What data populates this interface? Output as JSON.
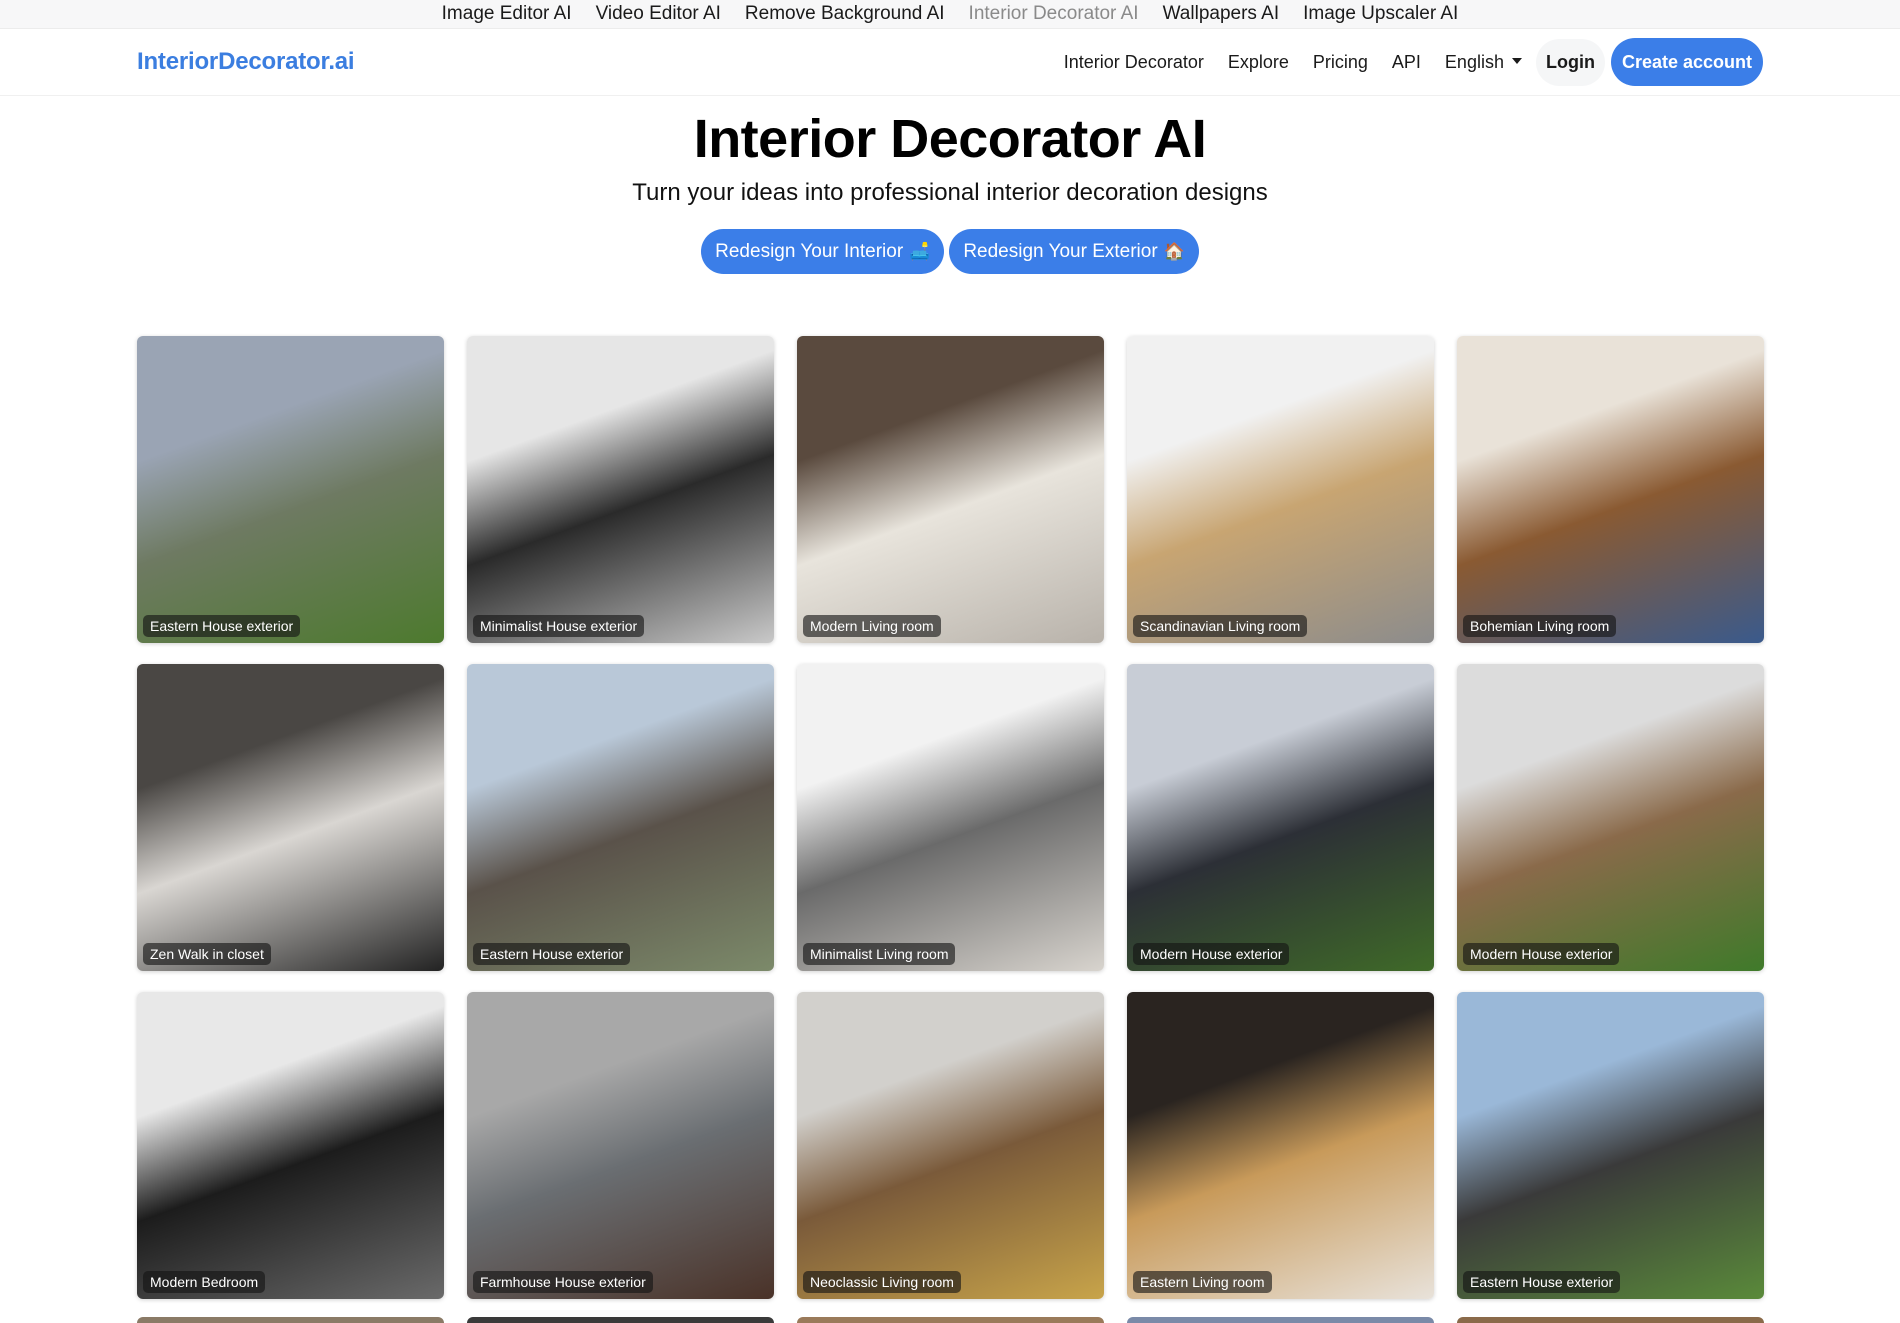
{
  "product_bar": {
    "items": [
      {
        "label": "Image Editor AI",
        "active": false
      },
      {
        "label": "Video Editor AI",
        "active": false
      },
      {
        "label": "Remove Background AI",
        "active": false
      },
      {
        "label": "Interior Decorator AI",
        "active": true
      },
      {
        "label": "Wallpapers AI",
        "active": false
      },
      {
        "label": "Image Upscaler AI",
        "active": false
      }
    ]
  },
  "navbar": {
    "brand": "InteriorDecorator.ai",
    "links": [
      "Interior Decorator",
      "Explore",
      "Pricing",
      "API"
    ],
    "language": "English",
    "login_label": "Login",
    "create_account_label": "Create account"
  },
  "hero": {
    "title": "Interior Decorator AI",
    "subtitle": "Turn your ideas into professional interior decoration designs",
    "buttons": [
      {
        "label": "Redesign Your Interior",
        "emoji": "🛋️"
      },
      {
        "label": "Redesign Your Exterior",
        "emoji": "🏠"
      }
    ]
  },
  "colors": {
    "brand": "#3b7ee0",
    "button": "#3b7ee8"
  },
  "gallery": {
    "items": [
      {
        "label": "Eastern House exterior",
        "palette": [
          "#9aa4b4",
          "#6e7a62",
          "#4d7a2e"
        ]
      },
      {
        "label": "Minimalist House exterior",
        "palette": [
          "#e6e6e6",
          "#2a2a2a",
          "#c9c9c9"
        ]
      },
      {
        "label": "Modern Living room",
        "palette": [
          "#5a4a3e",
          "#e8e4dc",
          "#b8b2aa"
        ]
      },
      {
        "label": "Scandinavian Living room",
        "palette": [
          "#f1f1f1",
          "#c8a572",
          "#8c8c8c"
        ]
      },
      {
        "label": "Bohemian Living room",
        "palette": [
          "#e9e2d8",
          "#8a5a32",
          "#3a5a8c"
        ]
      },
      {
        "label": "Zen Walk in closet",
        "palette": [
          "#4a4744",
          "#d9d6d2",
          "#222222"
        ]
      },
      {
        "label": "Eastern House exterior",
        "palette": [
          "#b9c8d8",
          "#5a524a",
          "#7c8a6a"
        ]
      },
      {
        "label": "Minimalist Living room",
        "palette": [
          "#f2f2f2",
          "#6a6a6a",
          "#d8d4ce"
        ]
      },
      {
        "label": "Modern House exterior",
        "palette": [
          "#c8cdd6",
          "#2c2f36",
          "#3f6a28"
        ]
      },
      {
        "label": "Modern House exterior",
        "palette": [
          "#dcdcdc",
          "#8a6a4a",
          "#3f7a2a"
        ]
      },
      {
        "label": "Modern Bedroom",
        "palette": [
          "#e8e8e8",
          "#1c1c1c",
          "#6a6a6a"
        ]
      },
      {
        "label": "Farmhouse House exterior",
        "palette": [
          "#a8a8a8",
          "#6a6e72",
          "#4a3228"
        ]
      },
      {
        "label": "Neoclassic Living room",
        "palette": [
          "#d2d0cc",
          "#7a5a3a",
          "#c8a44a"
        ]
      },
      {
        "label": "Eastern Living room",
        "palette": [
          "#2a2420",
          "#c89a5a",
          "#e8e2da"
        ]
      },
      {
        "label": "Eastern House exterior",
        "palette": [
          "#9ab8d8",
          "#3a3a3a",
          "#5a8a3a"
        ]
      }
    ]
  }
}
